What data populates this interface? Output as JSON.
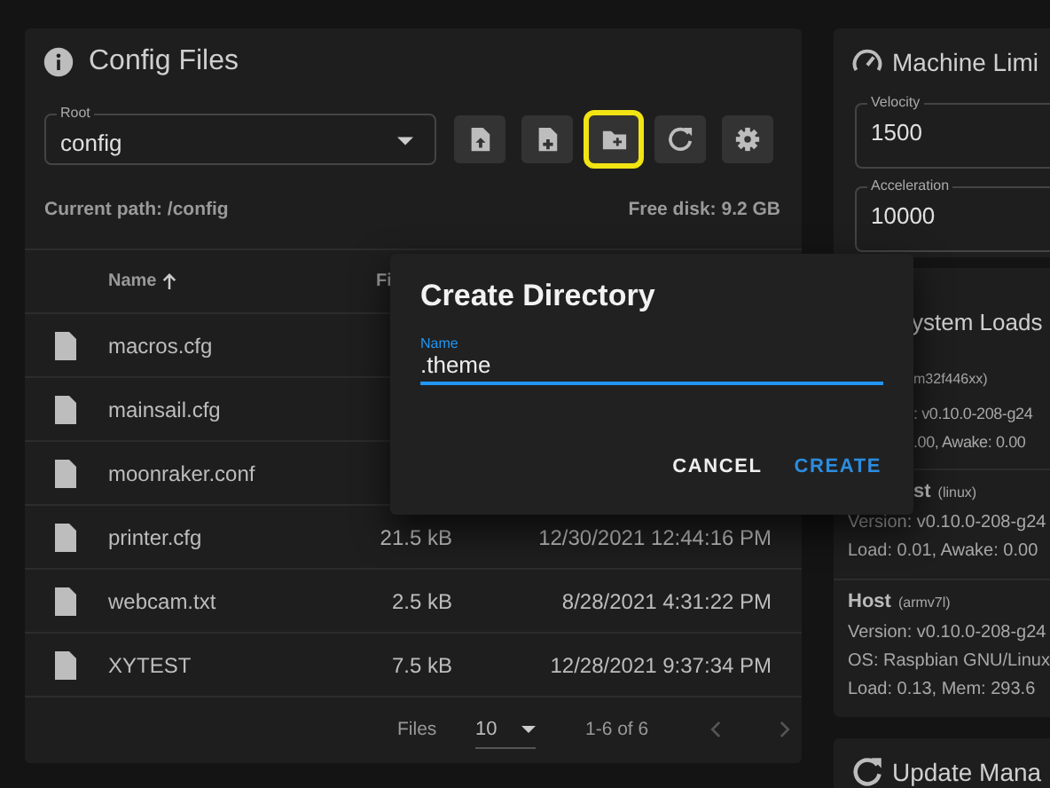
{
  "config_files": {
    "title": "Config Files",
    "root_select": {
      "label": "Root",
      "value": "config"
    },
    "toolbar": [
      {
        "kind": "upload",
        "highlighted": false
      },
      {
        "kind": "new-file",
        "highlighted": false
      },
      {
        "kind": "new-folder",
        "highlighted": true
      },
      {
        "kind": "refresh",
        "highlighted": false
      },
      {
        "kind": "settings",
        "highlighted": false
      }
    ],
    "current_path": "Current path: /config",
    "free_disk": "Free disk: 9.2 GB",
    "table": {
      "columns": [
        {
          "label": "Name",
          "sorted": true
        },
        {
          "label": "Fi",
          "sorted": false
        }
      ],
      "rows": [
        {
          "name": "macros.cfg"
        },
        {
          "name": "mainsail.cfg"
        },
        {
          "name": "moonraker.conf"
        },
        {
          "name": "printer.cfg",
          "size": "21.5 kB",
          "modified": "12/30/2021 12:44:16 PM"
        },
        {
          "name": "webcam.txt",
          "size": "2.5 kB",
          "modified": "8/28/2021 4:31:22 PM"
        },
        {
          "name": "XYTEST",
          "size": "7.5 kB",
          "modified": "12/28/2021 9:37:34 PM"
        }
      ]
    },
    "pagination": {
      "label": "Files",
      "per_page": "10",
      "range": "1-6 of 6"
    }
  },
  "machine_limits": {
    "title": "Machine Limi",
    "fields": [
      {
        "label": "Velocity",
        "value": "1500"
      },
      {
        "label": "Acceleration",
        "value": "10000"
      }
    ]
  },
  "system_loads": {
    "title": "ystem Loads",
    "sections": [
      {
        "detail": "m32f446xx)",
        "lines": [
          ": v0.10.0-208-g24",
          ".00, Awake: 0.00"
        ]
      },
      {
        "name": "st",
        "detail": "(linux)",
        "lines": [
          "Version: v0.10.0-208-g24",
          "Load: 0.01, Awake: 0.00"
        ]
      },
      {
        "name": "Host",
        "detail": "(armv7l)",
        "lines": [
          "Version: v0.10.0-208-g24",
          "OS: Raspbian GNU/Linux",
          "Load: 0.13, Mem: 293.6"
        ]
      }
    ]
  },
  "update_manager": {
    "title": "Update Mana"
  },
  "dialog": {
    "title": "Create Directory",
    "field": {
      "label": "Name",
      "value": ".theme"
    },
    "buttons": [
      {
        "label": "CANCEL",
        "primary": false
      },
      {
        "label": "CREATE",
        "primary": true
      }
    ]
  }
}
